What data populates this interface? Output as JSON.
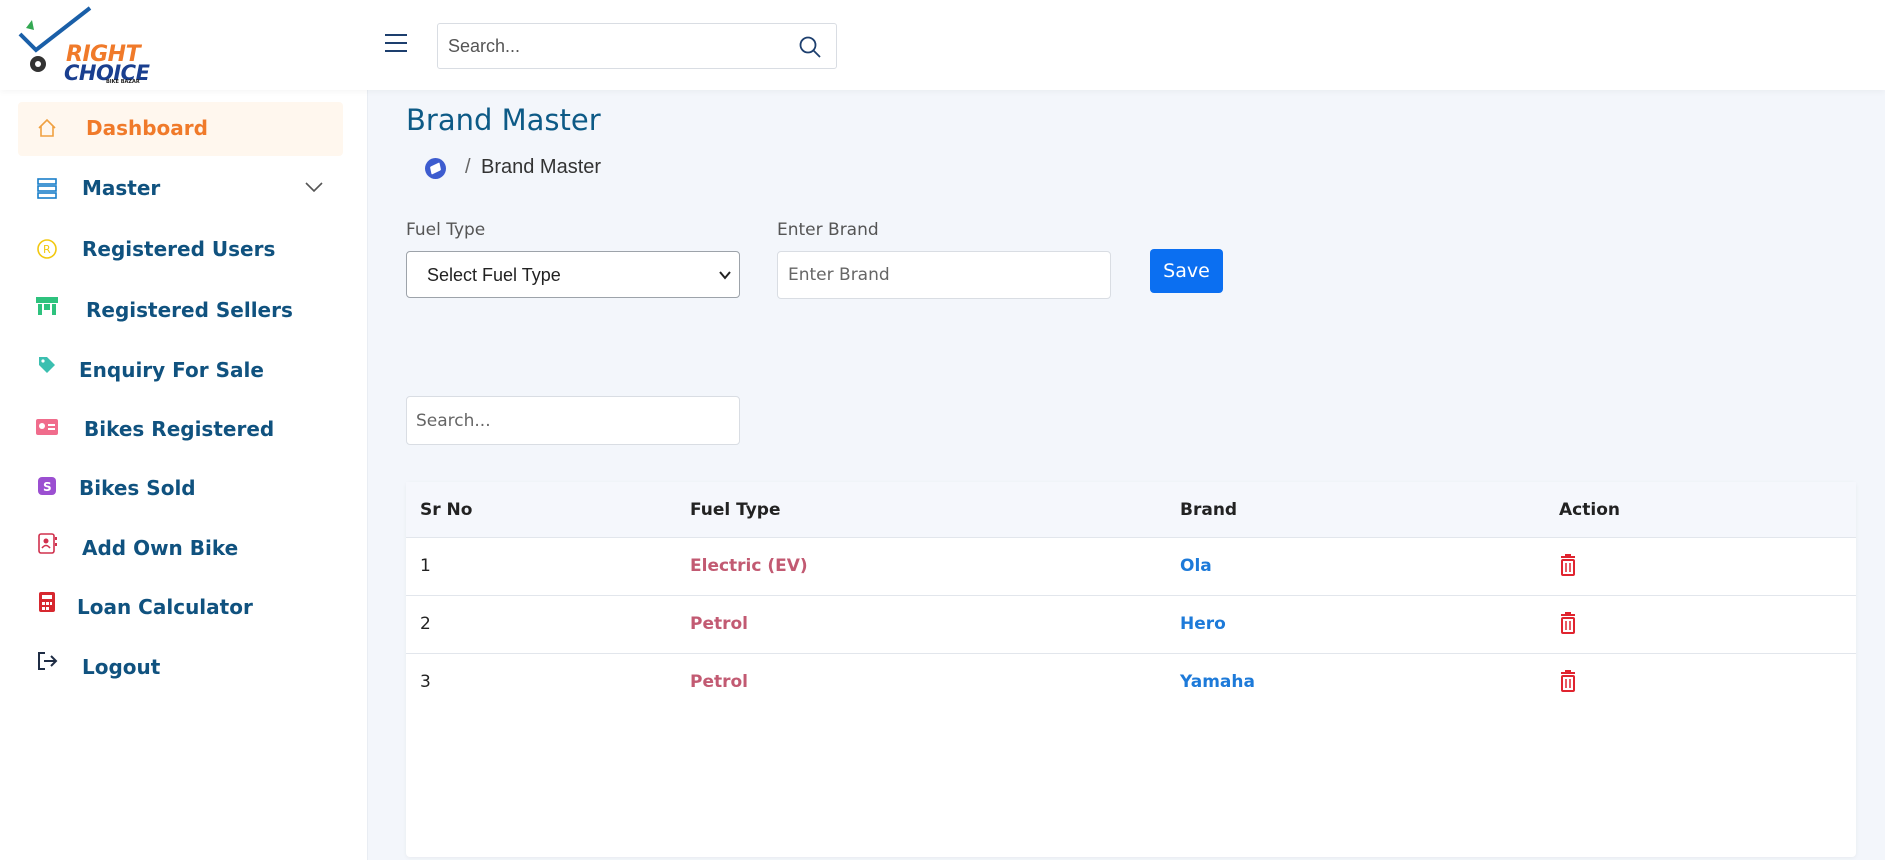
{
  "brand": {
    "logo_line1": "RIGHT",
    "logo_line2": "CHOICE",
    "logo_tagline": "BIKE BAZAR"
  },
  "header": {
    "search_placeholder": "Search..."
  },
  "sidebar": {
    "items": [
      {
        "label": "Dashboard",
        "icon": "home-icon",
        "active": true
      },
      {
        "label": "Master",
        "icon": "server-icon",
        "expandable": true
      },
      {
        "label": "Registered Users",
        "icon": "registered-icon"
      },
      {
        "label": "Registered Sellers",
        "icon": "shop-icon"
      },
      {
        "label": "Enquiry For Sale",
        "icon": "tag-icon"
      },
      {
        "label": "Bikes Registered",
        "icon": "id-card-icon"
      },
      {
        "label": "Bikes Sold",
        "icon": "dollar-badge-icon"
      },
      {
        "label": "Add Own Bike",
        "icon": "contact-book-icon"
      },
      {
        "label": "Loan Calculator",
        "icon": "calculator-icon"
      },
      {
        "label": "Logout",
        "icon": "logout-icon"
      }
    ]
  },
  "page": {
    "title": "Brand Master",
    "breadcrumb_current": "Brand Master",
    "breadcrumb_separator": "/"
  },
  "form": {
    "fuel_label": "Fuel Type",
    "fuel_selected": "Select Fuel Type",
    "brand_label": "Enter Brand",
    "brand_placeholder": "Enter Brand",
    "save_label": "Save"
  },
  "table": {
    "search_placeholder": "Search...",
    "columns": [
      "Sr No",
      "Fuel Type",
      "Brand",
      "Action"
    ],
    "rows": [
      {
        "sr": "1",
        "fuel": "Electric (EV)",
        "brand": "Ola"
      },
      {
        "sr": "2",
        "fuel": "Petrol",
        "brand": "Hero"
      },
      {
        "sr": "3",
        "fuel": "Petrol",
        "brand": "Yamaha"
      }
    ]
  },
  "colors": {
    "accent_orange": "#f07a2a",
    "nav_text": "#10527f",
    "primary_button": "#0b6ff1",
    "delete_red": "#e0242f"
  }
}
